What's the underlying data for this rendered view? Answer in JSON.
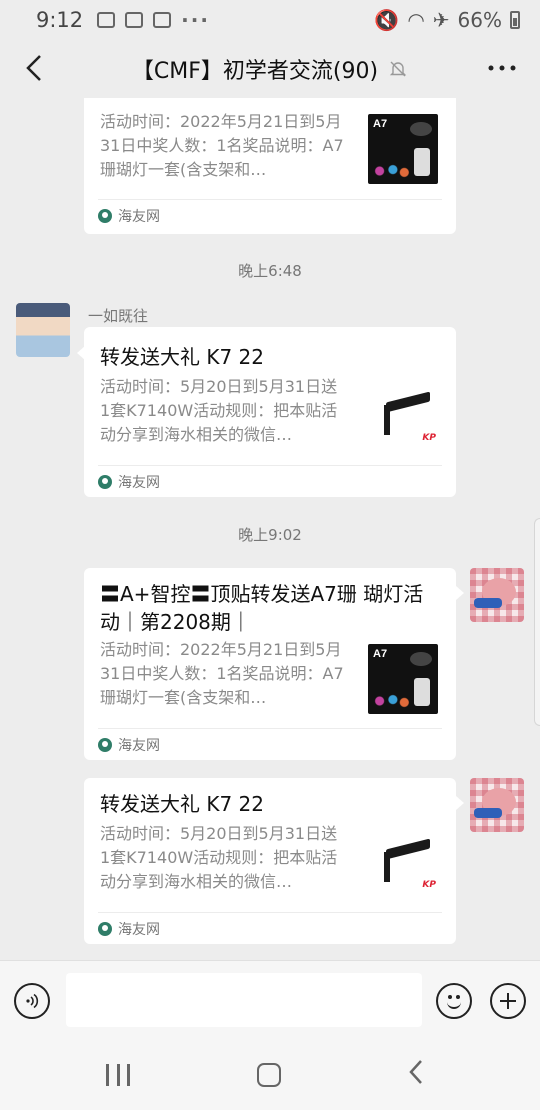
{
  "status_bar": {
    "time": "9:12",
    "battery": "66%"
  },
  "header": {
    "title": "【CMF】初学者交流(90)"
  },
  "chat": {
    "messages": [
      {
        "desc": "活动时间：2022年5月21日到5月31日中奖人数：1名奖品说明：A7珊瑚灯一套(含支架和…",
        "source": "海友网",
        "thumb_label": "A7"
      },
      {
        "time": "晚上6:48"
      },
      {
        "sender": "一如既往",
        "title": "转发送大礼 K7 22",
        "desc": "活动时间：5月20日到5月31日送1套K7140W活动规则：把本贴活动分享到海水相关的微信…",
        "source": "海友网"
      },
      {
        "time": "晚上9:02"
      },
      {
        "title": "〓A+智控〓顶贴转发送A7珊 瑚灯活动｜第2208期｜",
        "desc": "活动时间：2022年5月21日到5月31日中奖人数：1名奖品说明：A7珊瑚灯一套(含支架和…",
        "source": "海友网",
        "thumb_label": "A7"
      },
      {
        "title": "转发送大礼 K7 22",
        "desc": "活动时间：5月20日到5月31日送1套K7140W活动规则：把本贴活动分享到海水相关的微信…",
        "source": "海友网"
      }
    ]
  },
  "icons": {
    "back": "chevron-left-icon",
    "mute": "bell-off-icon",
    "more": "more-icon",
    "voice": "voice-icon",
    "emoji": "emoji-icon",
    "plus": "plus-icon"
  },
  "colors": {
    "background": "#ededed",
    "card": "#ffffff",
    "source_icon": "#2f7d68"
  }
}
